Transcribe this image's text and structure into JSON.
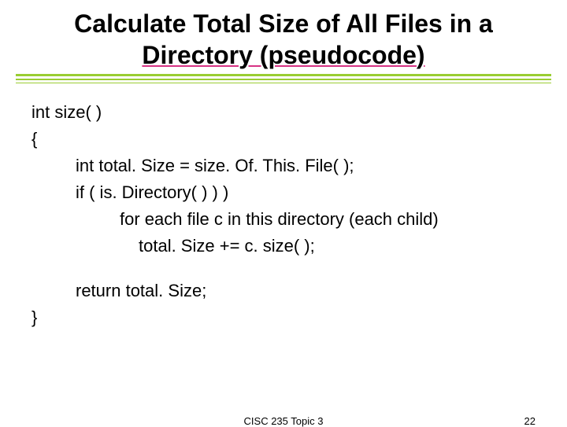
{
  "title": {
    "line1": "Calculate Total Size of All Files in a",
    "line2": "Directory (pseudocode)"
  },
  "code": {
    "l1": "int size( )",
    "l2": "{",
    "l3": "int total. Size = size. Of. This. File( );",
    "l4": "if ( is. Directory( ) ) )",
    "l5": "for each file c in this directory (each child)",
    "l6": "total. Size += c. size( );",
    "l7": "return total. Size;",
    "l8": "}"
  },
  "footer": {
    "center": "CISC 235 Topic 3",
    "page": "22"
  }
}
